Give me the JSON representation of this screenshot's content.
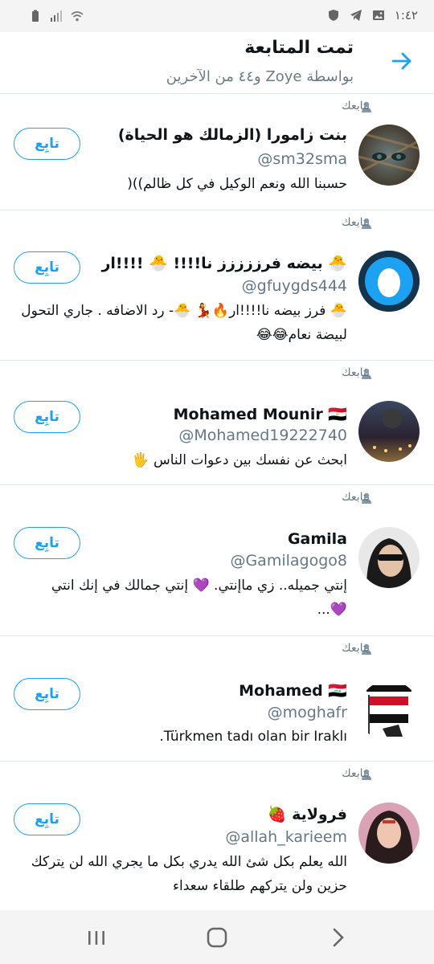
{
  "status_bar": {
    "time": "١:٤٢",
    "icons": [
      "battery-icon",
      "signal-icon",
      "wifi-icon",
      "shield-icon",
      "telegram-icon",
      "gallery-icon"
    ]
  },
  "header": {
    "title": "تمت المتابعة",
    "subtitle": "بواسطة Zoye و٤٤ من الآخرين",
    "back_icon": "arrow-right-icon"
  },
  "follows_you_label": "يتابعك",
  "follow_label": "تابِع",
  "users": [
    {
      "name": "بنت زامورا (الزمالك هو الحياة)",
      "handle": "@sm32sma",
      "bio": "حسبنا الله ونعم الوكيل في كل ظالم))("
    },
    {
      "name": "🐣 بيضه فرززززز نا!!!! 🐣 !!!!ار",
      "handle": "@gfuygds444",
      "bio": "🐣 فرز بيضه نا!!!!ار🔥💃 🐣- رد الاضافه . جاري التحول لبيضة نعام😂😂"
    },
    {
      "name": "Mohamed Mounir 🇪🇬",
      "handle": "@Mohamed19222740",
      "bio": "ابحث عن نفسك بين دعوات الناس 🖐"
    },
    {
      "name": "Gamila",
      "handle": "@Gamilagogo8",
      "bio": "إنتي جميله.. زي ماإنتي. 💜 إنتي جمالك في إنك انتي 💜..."
    },
    {
      "name": "Mohamed 🇮🇶",
      "handle": "@moghafr",
      "bio": "Türkmen tadı olan bir Iraklı."
    },
    {
      "name": "فرولاية 🍓",
      "handle": "@allah_karieem",
      "bio": "الله يعلم بكل شئ الله يدري بكل ما يجري الله لن يتركك حزين ولن يتركهم طلقاء سعداء"
    }
  ],
  "nav": {
    "recents_icon": "recents-icon",
    "home_icon": "home-icon",
    "back_icon": "back-chevron-icon"
  },
  "colors": {
    "accent": "#1da1f2",
    "secondary_text": "#657786",
    "divider": "#e1e6ea"
  }
}
